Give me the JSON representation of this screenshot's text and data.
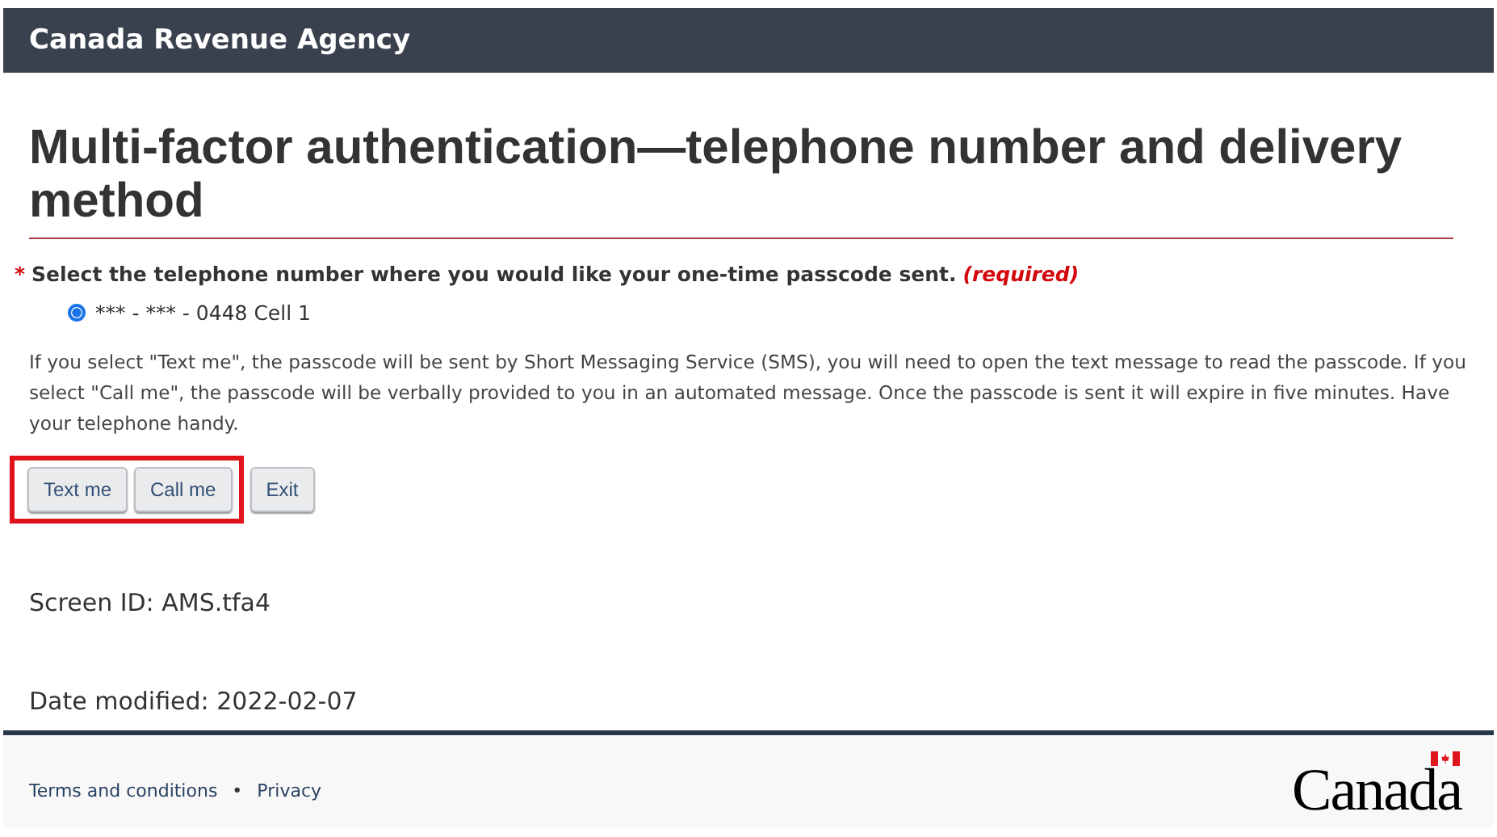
{
  "header": {
    "title": "Canada Revenue Agency"
  },
  "page_title": "Multi-factor authentication—telephone number and delivery method",
  "question": {
    "required_mark": "*",
    "label": "Select the telephone number where you would like your one-time passcode sent.",
    "required_text": "(required)"
  },
  "phone_options": [
    {
      "label": "*** - *** - 0448 Cell 1",
      "selected": true
    }
  ],
  "info": "If you select \"Text me\", the passcode will be sent by Short Messaging Service (SMS), you will need to open the text message to read the passcode. If you select \"Call me\", the passcode will be verbally provided to you in an automated message. Once the passcode is sent it will expire in five minutes. Have your telephone handy.",
  "buttons": [
    {
      "label": "Text me",
      "highlighted": true
    },
    {
      "label": "Call me",
      "highlighted": true
    },
    {
      "label": "Exit",
      "highlighted": false
    }
  ],
  "screen_id": "Screen ID: AMS.tfa4",
  "date_modified": "Date modified: 2022-02-07",
  "footer": {
    "links": [
      "Terms and conditions",
      "Privacy"
    ],
    "separator": "•",
    "wordmark": "Canada"
  }
}
